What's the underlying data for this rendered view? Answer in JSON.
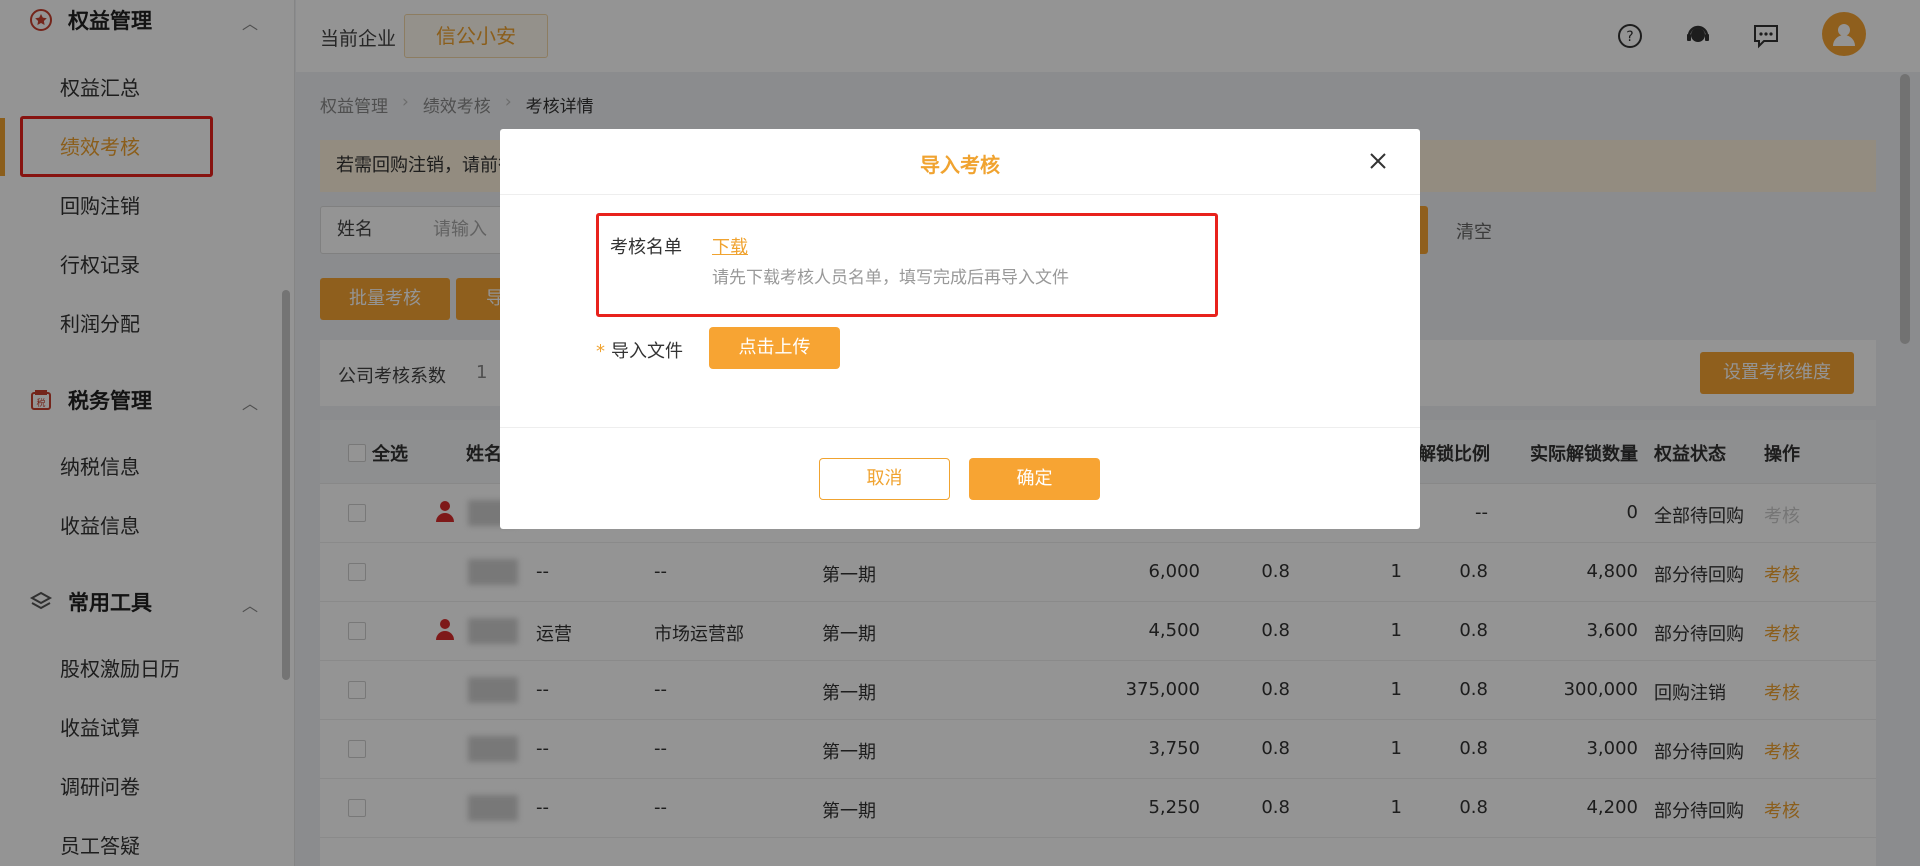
{
  "sidebar": {
    "groups": [
      {
        "title": "权益管理",
        "icon": "badge-icon",
        "items": [
          "权益汇总",
          "绩效考核",
          "回购注销",
          "行权记录",
          "利润分配"
        ]
      },
      {
        "title": "税务管理",
        "icon": "tax-icon",
        "items": [
          "纳税信息",
          "收益信息"
        ]
      },
      {
        "title": "常用工具",
        "icon": "layers-icon",
        "items": [
          "股权激励日历",
          "收益试算",
          "调研问卷",
          "员工答疑"
        ]
      }
    ],
    "active_item": "绩效考核"
  },
  "header": {
    "company_label": "当前企业",
    "company_name": "信公小安",
    "icons": [
      "help-icon",
      "customer-service-icon",
      "message-icon",
      "avatar"
    ]
  },
  "breadcrumb": [
    "权益管理",
    "绩效考核",
    "考核详情"
  ],
  "notice": "若需回购注销，请前往",
  "search": {
    "label": "姓名",
    "placeholder": "请输入",
    "clear": "清空"
  },
  "toolbar": {
    "batch": "批量考核",
    "import": "导"
  },
  "coef": {
    "label": "公司考核系数",
    "value": "1",
    "set_button": "设置考核维度"
  },
  "table": {
    "headers": [
      "全选",
      "姓名",
      "解锁比例",
      "实际解锁数量",
      "权益状态",
      "操作"
    ],
    "rows": [
      {
        "dept_a": "",
        "dept_b": "",
        "period": "",
        "amount": "",
        "c1": "",
        "c2": "",
        "ratio": "--",
        "actual": "0",
        "status": "全部待回购",
        "action": "考核",
        "disabled": true,
        "icon": true
      },
      {
        "dept_a": "--",
        "dept_b": "--",
        "period": "第一期",
        "amount": "6,000",
        "c1": "0.8",
        "c2": "1",
        "ratio": "0.8",
        "actual": "4,800",
        "status": "部分待回购",
        "action": "考核",
        "disabled": false,
        "icon": false
      },
      {
        "dept_a": "运营",
        "dept_b": "市场运营部",
        "period": "第一期",
        "amount": "4,500",
        "c1": "0.8",
        "c2": "1",
        "ratio": "0.8",
        "actual": "3,600",
        "status": "部分待回购",
        "action": "考核",
        "disabled": false,
        "icon": true
      },
      {
        "dept_a": "--",
        "dept_b": "--",
        "period": "第一期",
        "amount": "375,000",
        "c1": "0.8",
        "c2": "1",
        "ratio": "0.8",
        "actual": "300,000",
        "status": "回购注销",
        "action": "考核",
        "disabled": false,
        "icon": false
      },
      {
        "dept_a": "--",
        "dept_b": "--",
        "period": "第一期",
        "amount": "3,750",
        "c1": "0.8",
        "c2": "1",
        "ratio": "0.8",
        "actual": "3,000",
        "status": "部分待回购",
        "action": "考核",
        "disabled": false,
        "icon": false
      },
      {
        "dept_a": "--",
        "dept_b": "--",
        "period": "第一期",
        "amount": "5,250",
        "c1": "0.8",
        "c2": "1",
        "ratio": "0.8",
        "actual": "4,200",
        "status": "部分待回购",
        "action": "考核",
        "disabled": false,
        "icon": false
      }
    ]
  },
  "modal": {
    "title": "导入考核",
    "list_label": "考核名单",
    "download": "下载",
    "hint": "请先下载考核人员名单，填写完成后再导入文件",
    "required_mark": "*",
    "file_label": "导入文件",
    "upload": "点击上传",
    "cancel": "取消",
    "confirm": "确定"
  },
  "colors": {
    "accent": "#f7a433",
    "highlight": "#e8221c"
  }
}
